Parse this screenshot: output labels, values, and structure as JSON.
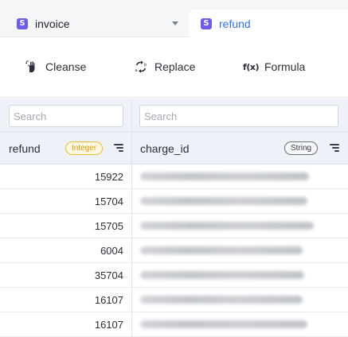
{
  "tabs": [
    {
      "label": "invoice",
      "icon": "s-logo-icon",
      "active": false
    },
    {
      "label": "refund",
      "icon": "s-logo-icon",
      "active": true
    }
  ],
  "tab_icon_letter": "S",
  "toolbar": {
    "cleanse_label": "Cleanse",
    "replace_label": "Replace",
    "formula_label": "Formula",
    "formula_icon": "f(x)"
  },
  "columns": [
    {
      "title": "refund",
      "type": "Integer",
      "search_placeholder": "Search"
    },
    {
      "title": "charge_id",
      "type": "String",
      "search_placeholder": "Search"
    }
  ],
  "rows": [
    {
      "refund": "15922"
    },
    {
      "refund": "15704"
    },
    {
      "refund": "15705"
    },
    {
      "refund": "6004"
    },
    {
      "refund": "35704"
    },
    {
      "refund": "16107"
    },
    {
      "refund": "16107"
    }
  ],
  "colors": {
    "accent": "#3a6fd8",
    "tab_icon": "#6c5ce7",
    "integer_badge": "#e8b93b"
  }
}
